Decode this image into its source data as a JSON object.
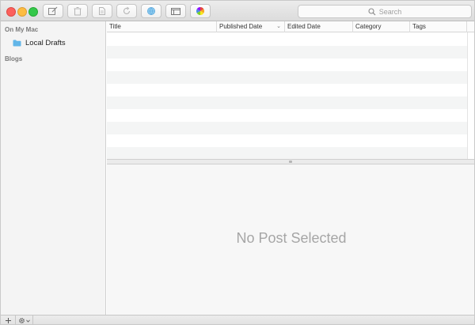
{
  "toolbar": {
    "buttons": [
      {
        "name": "new-post-icon"
      },
      {
        "name": "trash-icon"
      },
      {
        "name": "document-icon"
      },
      {
        "name": "refresh-icon"
      },
      {
        "name": "globe-icon"
      },
      {
        "name": "window-icon"
      },
      {
        "name": "color-wheel-icon"
      }
    ],
    "search_placeholder": "Search"
  },
  "sidebar": {
    "group_on_my_mac": "On My Mac",
    "local_drafts": "Local Drafts",
    "group_blogs": "Blogs"
  },
  "table": {
    "columns": [
      "Title",
      "Published Date",
      "Edited Date",
      "Category",
      "Tags"
    ],
    "sort_column": "Published Date",
    "sort_direction": "descending",
    "rows": []
  },
  "detail": {
    "empty_message": "No Post Selected"
  },
  "bottom_bar": {
    "add_icon": "plus-icon",
    "settings_icon": "gear-icon"
  },
  "colors": {
    "folder": "#62b6e8",
    "close": "#fc605c",
    "minimize": "#fdbc40",
    "zoom": "#34c84a",
    "empty_text": "#a6a6a6"
  }
}
